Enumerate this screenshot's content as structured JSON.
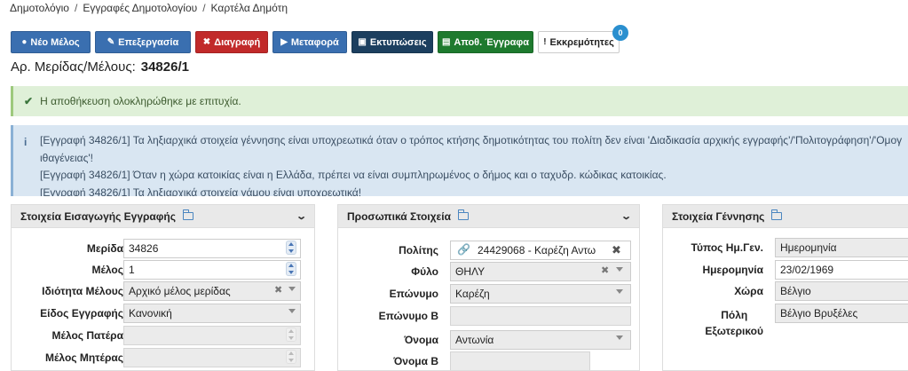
{
  "breadcrumb": [
    "Δημοτολόγιο",
    "Εγγραφές Δημοτολογίου",
    "Καρτέλα Δημότη"
  ],
  "breadcrumb_sep": "/",
  "toolbar": {
    "new_label": "Νέο Μέλος",
    "edit_label": "Επεξεργασία",
    "delete_label": "Διαγραφή",
    "move_label": "Μεταφορά",
    "print_label": "Εκτυπώσεις",
    "docs_label": "Αποθ. Έγγραφα",
    "pending_label": "Εκκρεμότητες",
    "pending_count": "0"
  },
  "record": {
    "label": "Αρ. Μερίδας/Μέλους:",
    "number": "34826/1"
  },
  "alerts": {
    "success": "Η αποθήκευση ολοκληρώθηκε με επιτυχία.",
    "info_lines": [
      "[Εγγραφή 34826/1] Τα ληξιαρχικά στοιχεία γέννησης είναι υποχρεωτικά όταν ο τρόπος κτήσης δημοτικότητας του πολίτη δεν είναι 'Διαδικασία αρχικής εγγραφής'/'Πολιτογράφηση'/'Ομογ",
      "ιθαγένειας'!",
      "[Εγγραφή 34826/1] Όταν η χώρα κατοικίας είναι η Ελλάδα, πρέπει να είναι συμπληρωμένος ο δήμος και ο ταχυδρ. κώδικας κατοικίας.",
      "[Εγγραφή 34826/1] Τα ληξιαρχικά στοιχεία γάμου είναι υποχρεωτικά!"
    ]
  },
  "panel_entry": {
    "title": "Στοιχεία Εισαγωγής Εγγραφής",
    "labels": {
      "merida": "Μερίδα",
      "melos": "Μέλος",
      "idiotita": "Ιδιότητα Μέλους",
      "eidos": "Είδος Εγγραφής",
      "pateras": "Μέλος Πατέρα",
      "mitera": "Μέλος Μητέρας"
    },
    "values": {
      "merida": "34826",
      "melos": "1",
      "idiotita": "Αρχικό μέλος μερίδας",
      "eidos": "Κανονική",
      "pateras": "",
      "mitera": ""
    }
  },
  "panel_personal": {
    "title": "Προσωπικά Στοιχεία",
    "labels": {
      "politis": "Πολίτης",
      "fylo": "Φύλο",
      "eponymo": "Επώνυμο",
      "eponymo_b": "Επώνυμο Β",
      "onoma": "Όνομα",
      "onoma_b": "Όνομα Β"
    },
    "values": {
      "politis": "24429068 - Καρέζη Αντω",
      "fylo": "ΘΗΛΥ",
      "eponymo": "Καρέζη",
      "eponymo_b": "",
      "onoma": "Αντωνία",
      "onoma_b": ""
    }
  },
  "panel_birth": {
    "title": "Στοιχεία Γέννησης",
    "labels": {
      "typos": "Τύπος Ημ.Γεν.",
      "date": "Ημερομηνία",
      "xwra": "Χώρα",
      "poli_1": "Πόλη",
      "poli_2": "Εξωτερικού"
    },
    "values": {
      "typos": "Ημερομηνία",
      "date": "23/02/1969",
      "xwra": "Βέλγιο",
      "poli": "Βέλγιο Βρυξέλες"
    }
  }
}
